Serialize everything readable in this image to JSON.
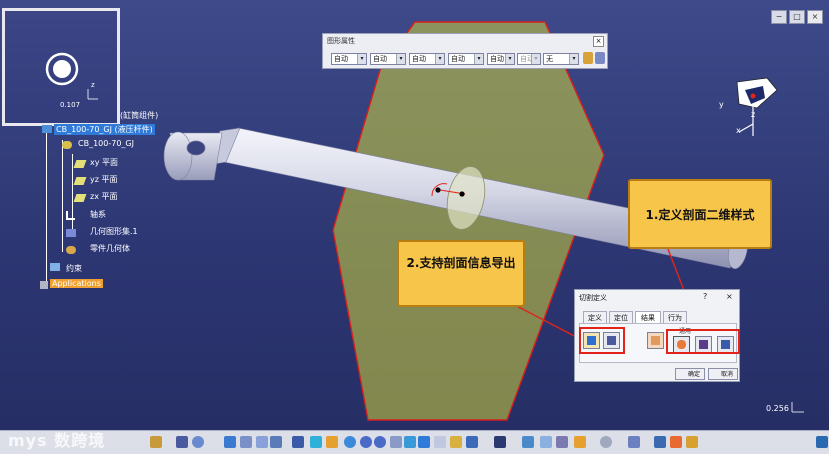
{
  "window": {
    "controls": [
      "−",
      "□",
      "×"
    ]
  },
  "preview": {
    "readout": "0.107",
    "axis_label": "z"
  },
  "tree": {
    "items": [
      {
        "label": "(缸筒组件)"
      },
      {
        "label": "CB_100-70_GJ (液压杆件)"
      },
      {
        "label": "CB_100-70_GJ"
      },
      {
        "label": "xy 平面"
      },
      {
        "label": "yz 平面"
      },
      {
        "label": "zx 平面"
      },
      {
        "label": "轴系"
      },
      {
        "label": "几何图形集.1"
      },
      {
        "label": "零件几何体"
      },
      {
        "label": "约束"
      },
      {
        "label": "Applications"
      }
    ]
  },
  "graphic_properties": {
    "title": "图形属性",
    "combos": [
      "自动",
      "自动",
      "自动",
      "自动",
      "自动",
      "自动",
      "无"
    ]
  },
  "callouts": {
    "style": "1.定义剖面二维样式",
    "export": "2.支持剖面信息导出"
  },
  "cut_dialog": {
    "title": "切割定义",
    "help": "?",
    "close": "×",
    "tabs": [
      "定义",
      "定位",
      "结果",
      "行为"
    ],
    "group_label": "通用",
    "ok_label": "确定",
    "cancel_label": "取消"
  },
  "compass": {
    "x": "x",
    "y": "y",
    "z": "z"
  },
  "zoom_readout": "0.256",
  "watermark": "mys 数跨境",
  "colors": {
    "accent_red": "#e2231a",
    "callout_fill": "#f7c54a",
    "highlight_blue": "#2f79d8"
  }
}
